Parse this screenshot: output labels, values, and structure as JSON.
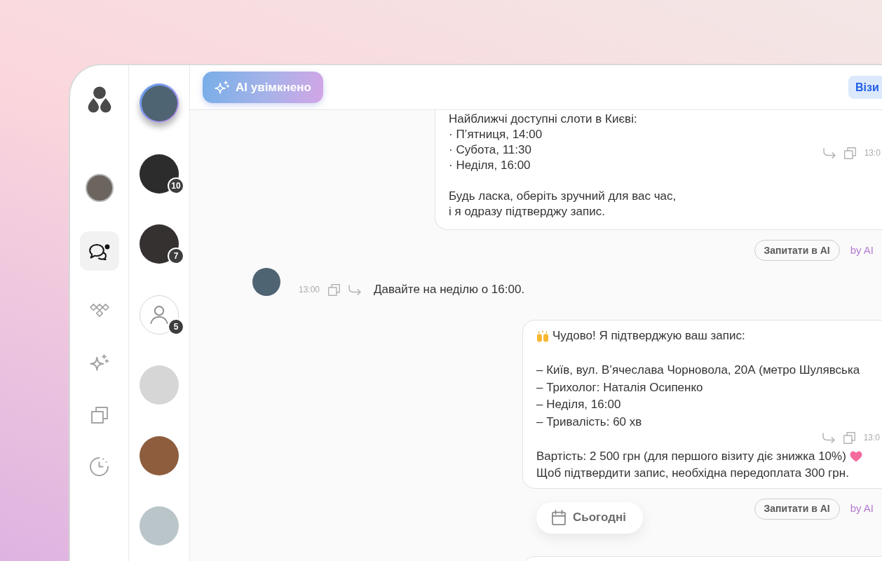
{
  "ai_toggle": {
    "label": "AI увімкнено",
    "on": true
  },
  "visit_button": {
    "label": "Візи"
  },
  "nav_items": [
    {
      "kind": "avatar",
      "selected": false
    },
    {
      "kind": "icon",
      "selected": true
    },
    {
      "kind": "icon",
      "selected": false
    },
    {
      "kind": "icon",
      "selected": false
    },
    {
      "kind": "icon",
      "selected": false
    },
    {
      "kind": "icon",
      "selected": false
    }
  ],
  "conversations": [
    {
      "kind": "photo",
      "selected": true
    },
    {
      "kind": "photo",
      "selected": false,
      "badge": "10"
    },
    {
      "kind": "photo",
      "selected": false,
      "badge": "7"
    },
    {
      "kind": "placeholder",
      "selected": false,
      "badge": "5"
    },
    {
      "kind": "photo",
      "selected": false
    },
    {
      "kind": "photo",
      "selected": false
    },
    {
      "kind": "photo",
      "selected": false
    }
  ],
  "messages": [
    {
      "kind": "bot",
      "paragraphs": [
        [
          {
            "text": "Найближчі доступні слоти в Києві:"
          },
          {
            "text": "· П’ятниця, 14:00"
          },
          {
            "text": "· Субота, 11:30"
          },
          {
            "text": "· Неділя, 16:00"
          }
        ],
        [
          {
            "text": "Будь ласка, оберіть зручний для вас час,"
          },
          {
            "text": "і я одразу підтверджу запис."
          }
        ]
      ],
      "time": "13:0",
      "ask_button": "Запитати в AI",
      "source": "by AI"
    },
    {
      "kind": "user",
      "time": "13:00",
      "text": "Давайте на неділю о 16:00."
    },
    {
      "kind": "bot",
      "paragraphs": [
        [
          {
            "text": "Чудово! Я підтверджую ваш запис:",
            "emoji_before": true
          }
        ],
        [
          {
            "text": "– Київ, вул. В’ячеслава Чорновола, 20А (метро Шулявська"
          },
          {
            "text": "– Трихолог: Наталія Осипенко"
          },
          {
            "text": "– Неділя, 16:00"
          },
          {
            "text": "– Тривалість: 60 хв"
          }
        ],
        [
          {
            "text": "Вартість: 2 500 грн (для першого візиту діє знижка 10%)",
            "emoji_after": true
          },
          {
            "text": "Щоб підтвердити запис, необхідна передоплата 300 грн."
          }
        ]
      ],
      "time": "13:0",
      "ask_button": "Запитати в AI",
      "source": "by AI",
      "date_chip": "Сьогодні"
    },
    {
      "kind": "bot"
    }
  ]
}
